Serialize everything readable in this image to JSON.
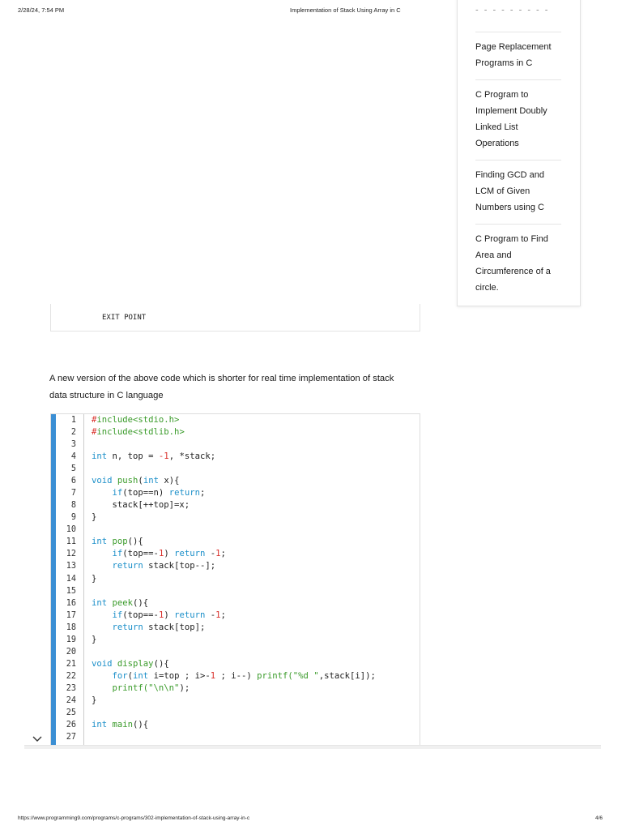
{
  "header": {
    "datetime": "2/28/24, 7:54 PM",
    "title": "Implementation of Stack Using Array in C"
  },
  "sidebar": {
    "partial": "- - - - - - - - -",
    "items": [
      {
        "label": "Page Replacement Programs in C",
        "lines": [
          "Page Replacement",
          "Programs in C"
        ]
      },
      {
        "label": "C Program to Implement Doubly Linked List Operations",
        "lines": [
          "C Program to",
          "Implement Doubly",
          "Linked List",
          "Operations"
        ]
      },
      {
        "label": "Finding GCD and LCM of Given Numbers using C",
        "lines": [
          "Finding GCD and",
          "LCM of Given",
          "Numbers using C"
        ]
      },
      {
        "label": "C Program to Find Area and Circumference of a circle.",
        "lines": [
          "C Program to Find",
          "Area and",
          "Circumference of a",
          "circle."
        ]
      }
    ]
  },
  "exit_point": "EXIT POINT",
  "paragraph": "A new version of the above code which is shorter for real time implementation of stack data structure in C language",
  "colors": {
    "keyword": "#1b8fc9",
    "func": "#3a9b2a",
    "number": "#d9302b",
    "text": "#222222",
    "accent": "#3b8fd4"
  },
  "code": [
    [
      [
        "#",
        "number"
      ],
      [
        "include<stdio.h>",
        "func"
      ]
    ],
    [
      [
        "#",
        "number"
      ],
      [
        "include<stdlib.h>",
        "func"
      ]
    ],
    [],
    [
      [
        "int",
        "keyword"
      ],
      [
        " n, top = ",
        "text"
      ],
      [
        "-1",
        "number"
      ],
      [
        ", *stack;",
        "text"
      ]
    ],
    [],
    [
      [
        "void",
        "keyword"
      ],
      [
        " ",
        "text"
      ],
      [
        "push",
        "func"
      ],
      [
        "(",
        "text"
      ],
      [
        "int",
        "keyword"
      ],
      [
        " x){",
        "text"
      ]
    ],
    [
      [
        "    ",
        "text"
      ],
      [
        "if",
        "keyword"
      ],
      [
        "(top==n) ",
        "text"
      ],
      [
        "return",
        "keyword"
      ],
      [
        ";",
        "text"
      ]
    ],
    [
      [
        "    stack[++top]=x;",
        "text"
      ]
    ],
    [
      [
        "}",
        "text"
      ]
    ],
    [],
    [
      [
        "int",
        "keyword"
      ],
      [
        " ",
        "text"
      ],
      [
        "pop",
        "func"
      ],
      [
        "(){",
        "text"
      ]
    ],
    [
      [
        "    ",
        "text"
      ],
      [
        "if",
        "keyword"
      ],
      [
        "(top==-",
        "text"
      ],
      [
        "1",
        "number"
      ],
      [
        ") ",
        "text"
      ],
      [
        "return",
        "keyword"
      ],
      [
        " -",
        "text"
      ],
      [
        "1",
        "number"
      ],
      [
        ";",
        "text"
      ]
    ],
    [
      [
        "    ",
        "text"
      ],
      [
        "return",
        "keyword"
      ],
      [
        " stack[top--];",
        "text"
      ]
    ],
    [
      [
        "}",
        "text"
      ]
    ],
    [],
    [
      [
        "int",
        "keyword"
      ],
      [
        " ",
        "text"
      ],
      [
        "peek",
        "func"
      ],
      [
        "(){",
        "text"
      ]
    ],
    [
      [
        "    ",
        "text"
      ],
      [
        "if",
        "keyword"
      ],
      [
        "(top==-",
        "text"
      ],
      [
        "1",
        "number"
      ],
      [
        ") ",
        "text"
      ],
      [
        "return",
        "keyword"
      ],
      [
        " -",
        "text"
      ],
      [
        "1",
        "number"
      ],
      [
        ";",
        "text"
      ]
    ],
    [
      [
        "    ",
        "text"
      ],
      [
        "return",
        "keyword"
      ],
      [
        " stack[top];",
        "text"
      ]
    ],
    [
      [
        "}",
        "text"
      ]
    ],
    [],
    [
      [
        "void",
        "keyword"
      ],
      [
        " ",
        "text"
      ],
      [
        "display",
        "func"
      ],
      [
        "(){",
        "text"
      ]
    ],
    [
      [
        "    ",
        "text"
      ],
      [
        "for",
        "keyword"
      ],
      [
        "(",
        "text"
      ],
      [
        "int",
        "keyword"
      ],
      [
        " i=top ; i>-",
        "text"
      ],
      [
        "1",
        "number"
      ],
      [
        " ; i--) ",
        "text"
      ],
      [
        "printf(\"%d \"",
        "func"
      ],
      [
        ",stack[i]);",
        "text"
      ]
    ],
    [
      [
        "    ",
        "text"
      ],
      [
        "printf(\"\\n\\n\"",
        "func"
      ],
      [
        ");",
        "text"
      ]
    ],
    [
      [
        "}",
        "text"
      ]
    ],
    [],
    [
      [
        "int",
        "keyword"
      ],
      [
        " ",
        "text"
      ],
      [
        "main",
        "func"
      ],
      [
        "(){",
        "text"
      ]
    ],
    []
  ],
  "footer": {
    "url": "https://www.programming9.com/programs/c-programs/302-implementation-of-stack-using-array-in-c",
    "page": "4/6"
  }
}
